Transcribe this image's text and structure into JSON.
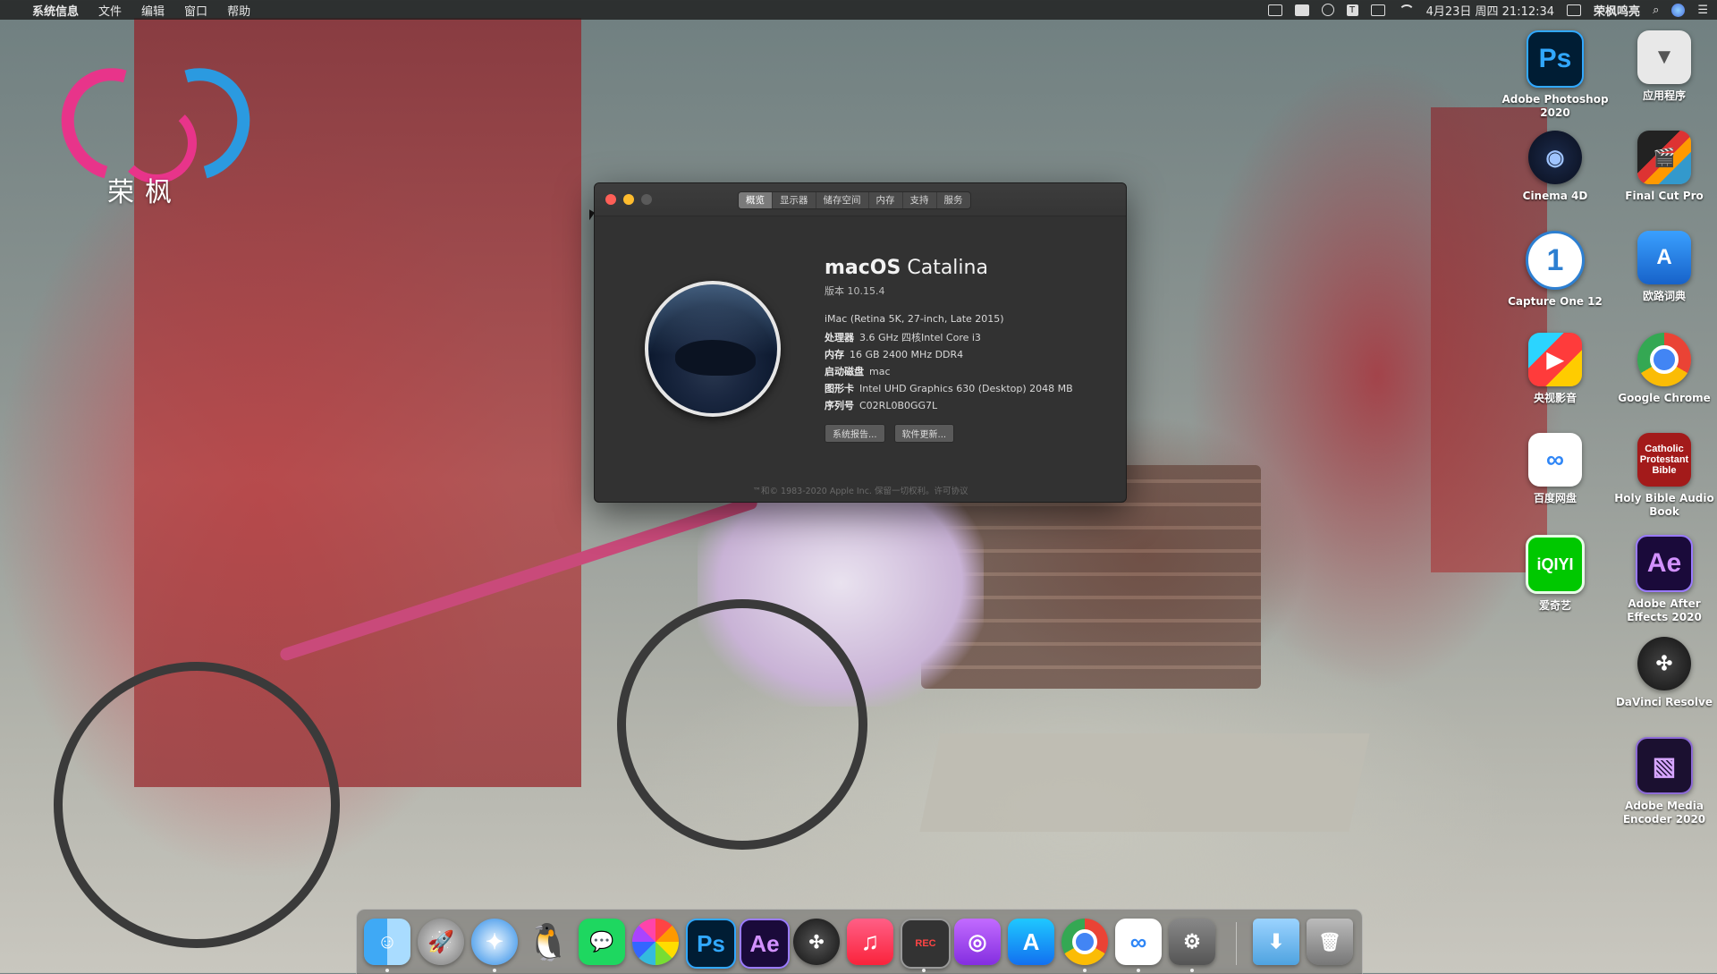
{
  "menubar": {
    "apple": "",
    "app_name": "系统信息",
    "menus": [
      "文件",
      "编辑",
      "窗口",
      "帮助"
    ],
    "datetime": "4月23日 周四 21:12:34",
    "input_method": "T",
    "user": "荣枫鸣亮"
  },
  "logo": {
    "text": "荣枫"
  },
  "about_window": {
    "tabs": [
      "概览",
      "显示器",
      "储存空间",
      "内存",
      "支持",
      "服务"
    ],
    "active_tab": 0,
    "os_name_bold": "macOS",
    "os_name": "Catalina",
    "version": "版本 10.15.4",
    "model": "iMac (Retina 5K, 27-inch, Late 2015)",
    "specs": [
      {
        "key": "处理器",
        "value": "3.6 GHz 四核Intel Core i3"
      },
      {
        "key": "内存",
        "value": "16 GB 2400 MHz DDR4"
      },
      {
        "key": "启动磁盘",
        "value": "mac"
      },
      {
        "key": "图形卡",
        "value": "Intel UHD Graphics 630 (Desktop) 2048 MB"
      },
      {
        "key": "序列号",
        "value": "C02RL0B0GG7L"
      }
    ],
    "buttons": [
      "系统报告...",
      "软件更新..."
    ],
    "footer": "™和© 1983-2020 Apple Inc. 保留一切权利。许可协议"
  },
  "desktop_icons": [
    {
      "label": "Adobe Photoshop 2020",
      "glyph": "Ps"
    },
    {
      "label": "应用程序",
      "glyph": "▼"
    },
    {
      "label": "Cinema 4D",
      "glyph": "◉"
    },
    {
      "label": "Final Cut Pro",
      "glyph": "🎬"
    },
    {
      "label": "Capture One 12",
      "glyph": "1"
    },
    {
      "label": "欧路词典",
      "glyph": "A"
    },
    {
      "label": "央视影音",
      "glyph": "▶"
    },
    {
      "label": "Google Chrome",
      "glyph": ""
    },
    {
      "label": "百度网盘",
      "glyph": "∞"
    },
    {
      "label": "Holy Bible Audio Book",
      "glyph": "Catholic Protestant Bible"
    },
    {
      "label": "爱奇艺",
      "glyph": "iQIYI"
    },
    {
      "label": "Adobe After Effects 2020",
      "glyph": "Ae"
    },
    {
      "label": "DaVinci Resolve",
      "glyph": "✣"
    },
    {
      "label": "Adobe Media Encoder 2020",
      "glyph": "▧"
    }
  ],
  "dock": {
    "apps": [
      {
        "name": "Finder",
        "glyph": "☺"
      },
      {
        "name": "Launchpad",
        "glyph": "🚀"
      },
      {
        "name": "Safari",
        "glyph": "✦"
      },
      {
        "name": "QQ",
        "glyph": "🐧"
      },
      {
        "name": "WeChat",
        "glyph": "💬"
      },
      {
        "name": "Photos",
        "glyph": ""
      },
      {
        "name": "Photoshop",
        "glyph": "Ps"
      },
      {
        "name": "After Effects",
        "glyph": "Ae"
      },
      {
        "name": "DaVinci Resolve",
        "glyph": "✣"
      },
      {
        "name": "Music",
        "glyph": "♫"
      },
      {
        "name": "Screen Recorder",
        "glyph": "REC"
      },
      {
        "name": "Podcasts",
        "glyph": "◎"
      },
      {
        "name": "App Store",
        "glyph": "A"
      },
      {
        "name": "Chrome",
        "glyph": ""
      },
      {
        "name": "Baidu Netdisk",
        "glyph": "∞"
      },
      {
        "name": "Utility",
        "glyph": "⚙"
      }
    ],
    "downloads_glyph": "⬇",
    "trash_glyph": "🗑"
  }
}
